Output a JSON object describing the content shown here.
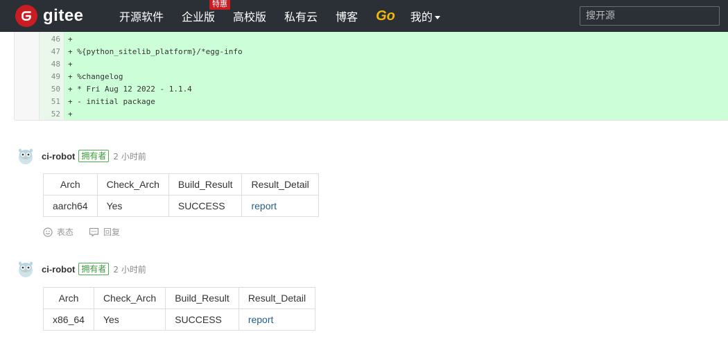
{
  "header": {
    "logo_text": "gitee",
    "nav": [
      {
        "label": "开源软件"
      },
      {
        "label": "企业版",
        "badge": "特惠"
      },
      {
        "label": "高校版"
      },
      {
        "label": "私有云"
      },
      {
        "label": "博客"
      },
      {
        "label": "Go"
      },
      {
        "label": "我的"
      }
    ],
    "search_placeholder": "搜开源"
  },
  "diff": {
    "lines": [
      {
        "num": "46",
        "code": "+"
      },
      {
        "num": "47",
        "code": "+ %{python_sitelib_platform}/*egg-info"
      },
      {
        "num": "48",
        "code": "+"
      },
      {
        "num": "49",
        "code": "+ %changelog"
      },
      {
        "num": "50",
        "code": "+ * Fri Aug 12 2022 - 1.1.4"
      },
      {
        "num": "51",
        "code": "+ - initial package"
      },
      {
        "num": "52",
        "code": "+"
      }
    ]
  },
  "comments": [
    {
      "author": "ci-robot",
      "role": "拥有者",
      "time": "2 小时前",
      "table": {
        "headers": [
          "Arch",
          "Check_Arch",
          "Build_Result",
          "Result_Detail"
        ],
        "row": [
          "aarch64",
          "Yes",
          "SUCCESS",
          "report"
        ]
      },
      "actions": {
        "react": "表态",
        "reply": "回复"
      }
    },
    {
      "author": "ci-robot",
      "role": "拥有者",
      "time": "2 小时前",
      "table": {
        "headers": [
          "Arch",
          "Check_Arch",
          "Build_Result",
          "Result_Detail"
        ],
        "row": [
          "x86_64",
          "Yes",
          "SUCCESS",
          "report"
        ]
      }
    }
  ],
  "colors": {
    "topbar": "#2b2f36",
    "brand_red": "#c71d23",
    "go_yellow": "#f0b90b",
    "diff_added": "#ccffd8",
    "link": "#245d8a",
    "owner_green": "#3a9a3a"
  }
}
